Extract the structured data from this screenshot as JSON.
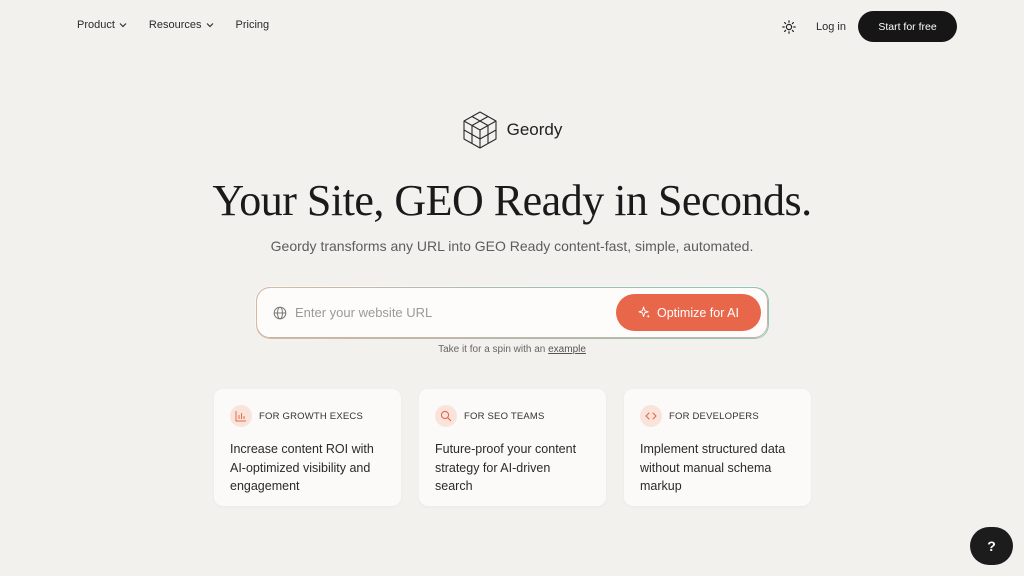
{
  "nav": {
    "product": "Product",
    "resources": "Resources",
    "pricing": "Pricing",
    "login": "Log in",
    "start": "Start for free"
  },
  "brand": {
    "name": "Geordy"
  },
  "hero": {
    "title": "Your Site, GEO Ready in Seconds.",
    "subtitle": "Geordy transforms any URL into GEO Ready content-fast, simple, automated."
  },
  "url_form": {
    "placeholder": "Enter your website URL",
    "value": "",
    "button": "Optimize for AI",
    "hint_prefix": "Take it for a spin with an",
    "hint_link": "example"
  },
  "cards": [
    {
      "tag": "FOR GROWTH EXECS",
      "icon": "bar-chart-icon",
      "text": "Increase content ROI with AI-optimized visibility and engagement"
    },
    {
      "tag": "FOR SEO TEAMS",
      "icon": "search-icon",
      "text": "Future-proof your content strategy for AI-driven search"
    },
    {
      "tag": "FOR DEVELOPERS",
      "icon": "code-icon",
      "text": "Implement structured data without manual schema markup"
    }
  ],
  "help": {
    "label": "?"
  },
  "colors": {
    "accent": "#e8674a",
    "dark": "#161616",
    "background": "#f3f1ee"
  }
}
